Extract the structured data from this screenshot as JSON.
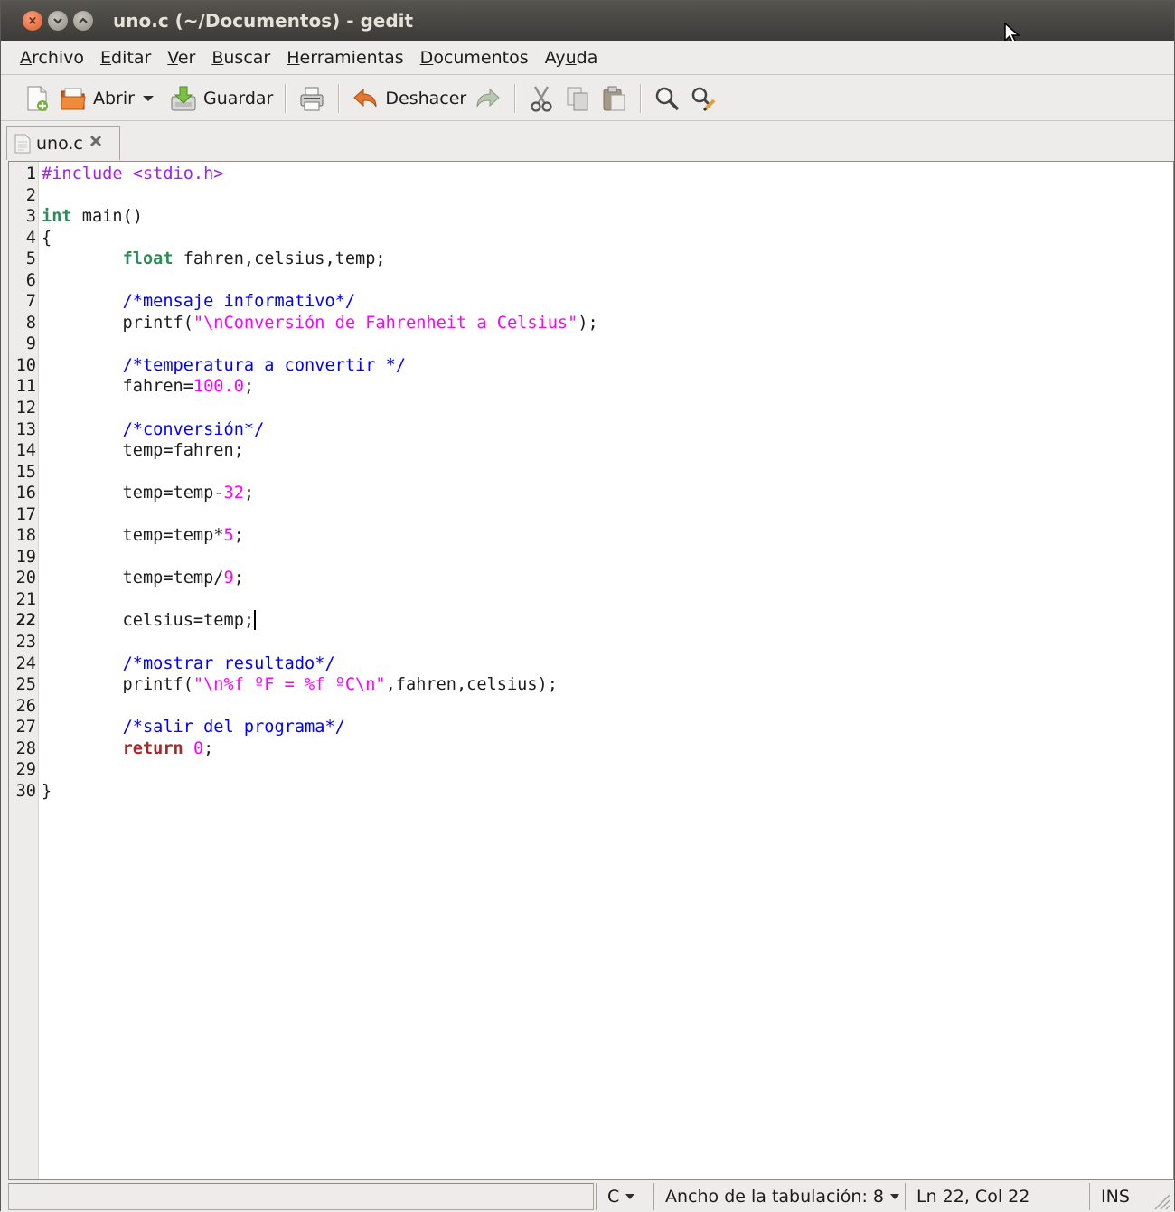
{
  "window": {
    "title": "uno.c (~/Documentos) - gedit"
  },
  "menubar": {
    "items": [
      {
        "mnemonic": "A",
        "rest": "rchivo"
      },
      {
        "mnemonic": "E",
        "rest": "ditar"
      },
      {
        "mnemonic": "V",
        "rest": "er"
      },
      {
        "mnemonic": "B",
        "rest": "uscar"
      },
      {
        "mnemonic": "H",
        "rest": "erramientas"
      },
      {
        "mnemonic": "D",
        "rest": "ocumentos"
      },
      {
        "pre": "Ay",
        "mnemonic": "u",
        "rest": "da"
      }
    ]
  },
  "toolbar": {
    "new_icon": "new-document-icon",
    "open_label": "Abrir",
    "open_icon": "folder-open-icon",
    "open_menu_icon": "dropdown-arrow-icon",
    "save_label": "Guardar",
    "save_icon": "save-icon",
    "print_icon": "printer-icon",
    "undo_label": "Deshacer",
    "undo_icon": "undo-icon",
    "redo_icon": "redo-icon",
    "cut_icon": "cut-icon",
    "copy_icon": "copy-icon",
    "paste_icon": "paste-icon",
    "find_icon": "search-icon",
    "replace_icon": "find-replace-icon"
  },
  "tabs": [
    {
      "label": "uno.c",
      "icon": "text-file-icon",
      "close_icon": "close-icon"
    }
  ],
  "editor": {
    "current_line": 22,
    "lines": [
      {
        "n": "1",
        "tokens": [
          [
            "pre",
            "#include <stdio.h>"
          ]
        ]
      },
      {
        "n": "2",
        "tokens": []
      },
      {
        "n": "3",
        "tokens": [
          [
            "type",
            "int"
          ],
          [
            "",
            " main()"
          ]
        ]
      },
      {
        "n": "4",
        "tokens": [
          [
            "",
            "{"
          ]
        ]
      },
      {
        "n": "5",
        "tokens": [
          [
            "",
            "        "
          ],
          [
            "type",
            "float"
          ],
          [
            "",
            " fahren,celsius,temp;"
          ]
        ]
      },
      {
        "n": "6",
        "tokens": []
      },
      {
        "n": "7",
        "tokens": [
          [
            "",
            "        "
          ],
          [
            "com",
            "/*mensaje informativo*/"
          ]
        ]
      },
      {
        "n": "8",
        "tokens": [
          [
            "",
            "        printf("
          ],
          [
            "str",
            "\"\\nConversión de Fahrenheit a Celsius\""
          ],
          [
            "",
            ");"
          ]
        ]
      },
      {
        "n": "9",
        "tokens": []
      },
      {
        "n": "10",
        "tokens": [
          [
            "",
            "        "
          ],
          [
            "com",
            "/*temperatura a convertir */"
          ]
        ]
      },
      {
        "n": "11",
        "tokens": [
          [
            "",
            "        fahren="
          ],
          [
            "num",
            "100.0"
          ],
          [
            "",
            ";"
          ]
        ]
      },
      {
        "n": "12",
        "tokens": []
      },
      {
        "n": "13",
        "tokens": [
          [
            "",
            "        "
          ],
          [
            "com",
            "/*conversión*/"
          ]
        ]
      },
      {
        "n": "14",
        "tokens": [
          [
            "",
            "        temp=fahren;"
          ]
        ]
      },
      {
        "n": "15",
        "tokens": []
      },
      {
        "n": "16",
        "tokens": [
          [
            "",
            "        temp=temp-"
          ],
          [
            "num",
            "32"
          ],
          [
            "",
            ";"
          ]
        ]
      },
      {
        "n": "17",
        "tokens": []
      },
      {
        "n": "18",
        "tokens": [
          [
            "",
            "        temp=temp*"
          ],
          [
            "num",
            "5"
          ],
          [
            "",
            ";"
          ]
        ]
      },
      {
        "n": "19",
        "tokens": []
      },
      {
        "n": "20",
        "tokens": [
          [
            "",
            "        temp=temp/"
          ],
          [
            "num",
            "9"
          ],
          [
            "",
            ";"
          ]
        ]
      },
      {
        "n": "21",
        "tokens": []
      },
      {
        "n": "22",
        "tokens": [
          [
            "",
            "        celsius=temp;"
          ]
        ],
        "caret": true
      },
      {
        "n": "23",
        "tokens": []
      },
      {
        "n": "24",
        "tokens": [
          [
            "",
            "        "
          ],
          [
            "com",
            "/*mostrar resultado*/"
          ]
        ]
      },
      {
        "n": "25",
        "tokens": [
          [
            "",
            "        printf("
          ],
          [
            "str",
            "\"\\n%f ºF = %f ºC\\n\""
          ],
          [
            "",
            ",fahren,celsius);"
          ]
        ]
      },
      {
        "n": "26",
        "tokens": []
      },
      {
        "n": "27",
        "tokens": [
          [
            "",
            "        "
          ],
          [
            "com",
            "/*salir del programa*/"
          ]
        ]
      },
      {
        "n": "28",
        "tokens": [
          [
            "",
            "        "
          ],
          [
            "kw",
            "return"
          ],
          [
            "",
            " "
          ],
          [
            "num",
            "0"
          ],
          [
            "",
            ";"
          ]
        ]
      },
      {
        "n": "29",
        "tokens": []
      },
      {
        "n": "30",
        "tokens": [
          [
            "",
            "}"
          ]
        ]
      }
    ]
  },
  "statusbar": {
    "language": "C",
    "tab_width": "Ancho de la tabulación: 8",
    "position": "Ln 22, Col 22",
    "mode": "INS"
  },
  "colors": {
    "preprocessor": "#a020f0",
    "string": "#ff00ff",
    "type": "#2e8b57",
    "keyword": "#a52a2a",
    "comment": "#0000ff"
  }
}
